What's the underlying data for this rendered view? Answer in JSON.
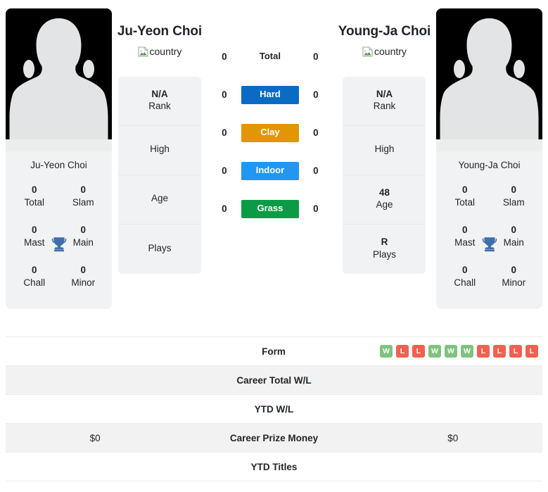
{
  "players": {
    "left": {
      "title": "Ju-Yeon Choi",
      "card_name": "Ju-Yeon Choi",
      "country_alt": "country",
      "titles": [
        {
          "value": "0",
          "label": "Total"
        },
        {
          "value": "0",
          "label": "Slam"
        },
        {
          "value": "0",
          "label": "Mast"
        },
        {
          "value": "0",
          "label": "Main"
        },
        {
          "value": "0",
          "label": "Chall"
        },
        {
          "value": "0",
          "label": "Minor"
        }
      ],
      "info": [
        {
          "value": "N/A",
          "label": "Rank"
        },
        {
          "value": "",
          "label": "High"
        },
        {
          "value": "",
          "label": "Age"
        },
        {
          "value": "",
          "label": "Plays"
        }
      ]
    },
    "right": {
      "title": "Young-Ja Choi",
      "card_name": "Young-Ja Choi",
      "country_alt": "country",
      "titles": [
        {
          "value": "0",
          "label": "Total"
        },
        {
          "value": "0",
          "label": "Slam"
        },
        {
          "value": "0",
          "label": "Mast"
        },
        {
          "value": "0",
          "label": "Main"
        },
        {
          "value": "0",
          "label": "Chall"
        },
        {
          "value": "0",
          "label": "Minor"
        }
      ],
      "info": [
        {
          "value": "N/A",
          "label": "Rank"
        },
        {
          "value": "",
          "label": "High"
        },
        {
          "value": "48",
          "label": "Age"
        },
        {
          "value": "R",
          "label": "Plays"
        }
      ]
    }
  },
  "surfaces": [
    {
      "left": "0",
      "label": "Total",
      "right": "0",
      "color": "",
      "plain": true
    },
    {
      "left": "0",
      "label": "Hard",
      "right": "0",
      "color": "#0b6bc4",
      "plain": false
    },
    {
      "left": "0",
      "label": "Clay",
      "right": "0",
      "color": "#e19606",
      "plain": false
    },
    {
      "left": "0",
      "label": "Indoor",
      "right": "0",
      "color": "#2196f3",
      "plain": false
    },
    {
      "left": "0",
      "label": "Grass",
      "right": "0",
      "color": "#0b9b46",
      "plain": false
    }
  ],
  "table": {
    "rows": [
      {
        "label": "Form",
        "left": "",
        "right": "",
        "alt": false,
        "type": "form"
      },
      {
        "label": "Career Total W/L",
        "left": "",
        "right": "",
        "alt": true,
        "type": "text"
      },
      {
        "label": "YTD W/L",
        "left": "",
        "right": "",
        "alt": false,
        "type": "text"
      },
      {
        "label": "Career Prize Money",
        "left": "$0",
        "right": "$0",
        "alt": true,
        "type": "text"
      },
      {
        "label": "YTD Titles",
        "left": "",
        "right": "",
        "alt": false,
        "type": "text"
      }
    ],
    "form_right": [
      "W",
      "L",
      "L",
      "W",
      "W",
      "W",
      "L",
      "L",
      "L",
      "L"
    ],
    "form_colors": {
      "W": "#7dc47d",
      "L": "#f2604f"
    }
  },
  "icons": {
    "trophy_color": "#3f6fad",
    "avatar_bg": "#000000",
    "avatar_fg": "#e3e4e5"
  }
}
